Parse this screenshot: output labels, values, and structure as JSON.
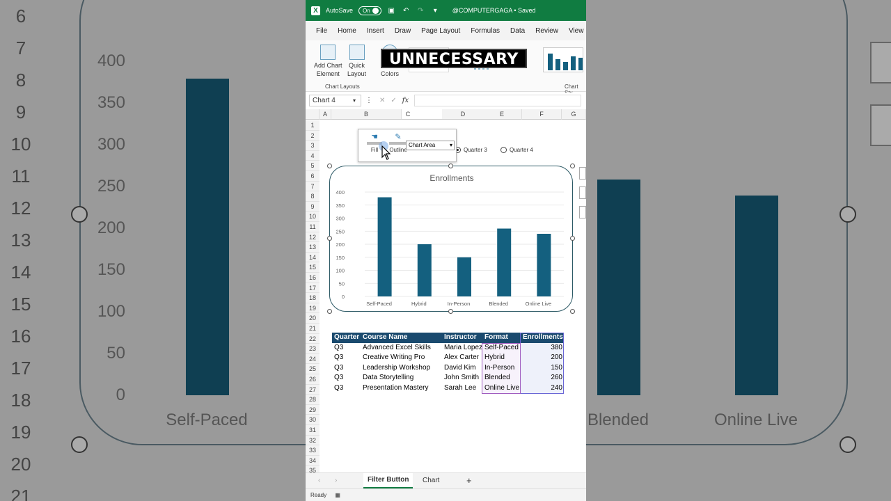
{
  "titlebar": {
    "autosave_label": "AutoSave",
    "autosave_state": "On",
    "doc_title": "@COMPUTERGAGA • Saved"
  },
  "menu": [
    "File",
    "Home",
    "Insert",
    "Draw",
    "Page Layout",
    "Formulas",
    "Data",
    "Review",
    "View"
  ],
  "ribbon": {
    "add_chart_element_1": "Add Chart",
    "add_chart_element_2": "Element",
    "quick_layout_1": "Quick",
    "quick_layout_2": "Layout",
    "colors_label": "Colors",
    "group_chart_layouts": "Chart Layouts",
    "group_chart_styles": "Chart Sty"
  },
  "caption": "UNNECESSARY",
  "formula_bar": {
    "name_box": "Chart 4",
    "fx": "fx"
  },
  "columns": [
    "A",
    "B",
    "C",
    "D",
    "E",
    "F",
    "G"
  ],
  "rows": [
    "1",
    "2",
    "3",
    "4",
    "5",
    "6",
    "7",
    "8",
    "9",
    "10",
    "11",
    "12",
    "13",
    "14",
    "15",
    "16",
    "17",
    "18",
    "19",
    "20",
    "21",
    "22",
    "23",
    "24",
    "25",
    "26",
    "27",
    "28",
    "29",
    "30",
    "31",
    "32",
    "33",
    "34",
    "35"
  ],
  "float_toolbar": {
    "fill_label": "Fill",
    "outline_label": "Outline",
    "element_select": "Chart Area"
  },
  "radio_options": [
    {
      "label": "Quarter 3",
      "selected": true
    },
    {
      "label": "Quarter 4",
      "selected": false
    }
  ],
  "chart_data": {
    "type": "bar",
    "title": "Enrollments",
    "categories": [
      "Self-Paced",
      "Hybrid",
      "In-Person",
      "Blended",
      "Online Live"
    ],
    "values": [
      380,
      200,
      150,
      260,
      240
    ],
    "ylim": [
      0,
      400
    ],
    "yticks": [
      "0",
      "50",
      "100",
      "150",
      "200",
      "250",
      "300",
      "350",
      "400"
    ],
    "grid": true,
    "bar_color": "#14607f"
  },
  "table": {
    "headers": [
      "Quarter",
      "Course Name",
      "Instructor",
      "Format",
      "Enrollments"
    ],
    "rows": [
      [
        "Q3",
        "Advanced Excel Skills",
        "Maria Lopez",
        "Self-Paced",
        "380"
      ],
      [
        "Q3",
        "Creative Writing Pro",
        "Alex Carter",
        "Hybrid",
        "200"
      ],
      [
        "Q3",
        "Leadership Workshop",
        "David Kim",
        "In-Person",
        "150"
      ],
      [
        "Q3",
        "Data Storytelling",
        "John Smith",
        "Blended",
        "260"
      ],
      [
        "Q3",
        "Presentation Mastery",
        "Sarah Lee",
        "Online Live",
        "240"
      ]
    ]
  },
  "sheet_tabs": [
    "Filter Button",
    "Chart"
  ],
  "status": "Ready",
  "colors": {
    "excel_green": "#107c41",
    "header_blue": "#1a4a6e"
  },
  "background": {
    "row_numbers": [
      "6",
      "7",
      "8",
      "9",
      "10",
      "11",
      "12",
      "13",
      "14",
      "15",
      "16",
      "17",
      "18",
      "19",
      "20",
      "21"
    ],
    "ticks": [
      "400",
      "350",
      "300",
      "250",
      "200",
      "150",
      "100",
      "50",
      "0"
    ],
    "categories": [
      "Self-Paced",
      "Blended",
      "Online Live"
    ]
  }
}
